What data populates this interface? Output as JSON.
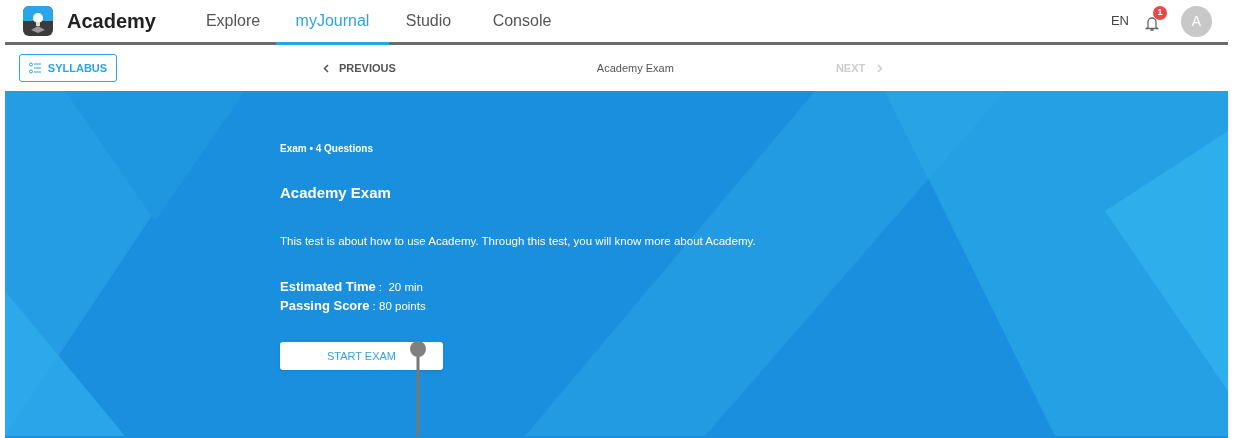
{
  "brand": {
    "name": "Academy"
  },
  "nav": [
    {
      "label": "Explore",
      "selected": false
    },
    {
      "label": "myJournal",
      "selected": true
    },
    {
      "label": "Studio",
      "selected": false
    },
    {
      "label": "Console",
      "selected": false
    }
  ],
  "language": "EN",
  "notifications": {
    "count": "1"
  },
  "avatar": {
    "initial": "A"
  },
  "toolbar": {
    "syllabus": "SYLLABUS",
    "previous": {
      "label": "PREVIOUS",
      "disabled": false
    },
    "title": "Academy Exam",
    "next": {
      "label": "NEXT",
      "disabled": true
    }
  },
  "exam": {
    "meta": "Exam • 4 Questions",
    "title": "Academy Exam",
    "description": "This test is about how to use Academy. Through this test, you will know more about Academy.",
    "details": [
      {
        "label": "Estimated Time",
        "value": ":  20 min"
      },
      {
        "label": "Passing Score",
        "value": ": 80 points"
      }
    ],
    "start_button": "START EXAM"
  }
}
